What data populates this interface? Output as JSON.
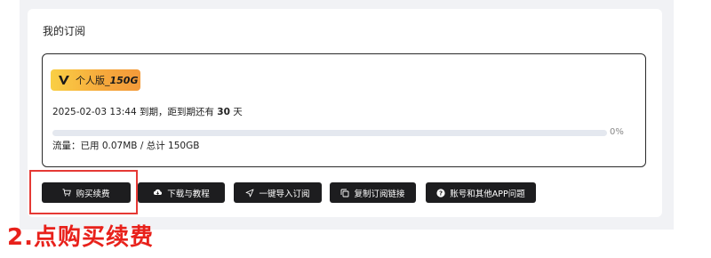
{
  "card": {
    "title": "我的订阅"
  },
  "subscription": {
    "plan_prefix": "个人版_",
    "plan_suffix": "150G",
    "expiry_prefix": "2025-02-03 13:44 到期，距到期还有 ",
    "expiry_days": "30",
    "expiry_suffix": " 天",
    "progress_percent": 0,
    "progress_label": "0%",
    "traffic_text": "流量：已用 0.07MB / 总计 150GB",
    "badge_colors": [
      "#f9cf45",
      "#f39a3a"
    ]
  },
  "buttons": [
    {
      "label": "购买续费",
      "icon": "cart-icon"
    },
    {
      "label": "下载与教程",
      "icon": "cloud-download-icon"
    },
    {
      "label": "一键导入订阅",
      "icon": "send-icon"
    },
    {
      "label": "复制订阅链接",
      "icon": "copy-icon"
    },
    {
      "label": "账号和其他APP问题",
      "icon": "question-icon"
    }
  ],
  "annotation": {
    "text": "2.点购买续费",
    "color": "#e8211b"
  }
}
